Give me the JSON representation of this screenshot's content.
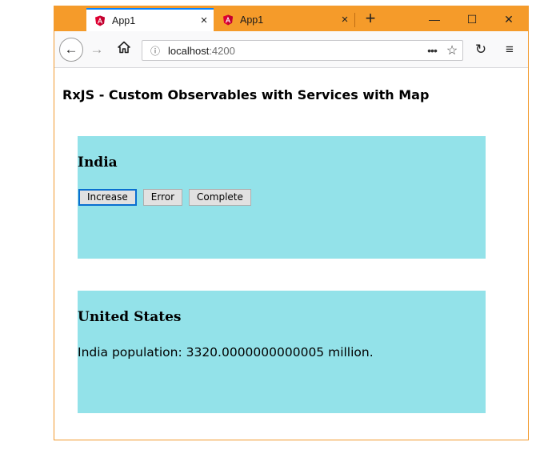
{
  "browser": {
    "tabs": [
      {
        "label": "App1",
        "close": "×"
      },
      {
        "label": "App1",
        "close": "×"
      }
    ],
    "new_tab": "+",
    "controls": {
      "minimize": "—",
      "maximize": "☐",
      "close": "✕"
    },
    "nav": {
      "back": "←",
      "forward": "→",
      "home": "⌂",
      "reload": "↻",
      "menu": "≡"
    },
    "url": {
      "host": "localhost",
      "port": ":4200",
      "info": "ⓘ",
      "dots": "•••",
      "star": "☆"
    }
  },
  "page": {
    "title": "RxJS - Custom Observables with Services with Map",
    "panels": [
      {
        "heading": "India",
        "buttons": [
          "Increase",
          "Error",
          "Complete"
        ]
      },
      {
        "heading": "United States",
        "text": "India population: 3320.0000000000005 million."
      }
    ]
  },
  "colors": {
    "titlebar": "#f59b2a",
    "panel": "#93e2e9",
    "active_tab_accent": "#0a84ff",
    "angular_red": "#dd0031"
  }
}
